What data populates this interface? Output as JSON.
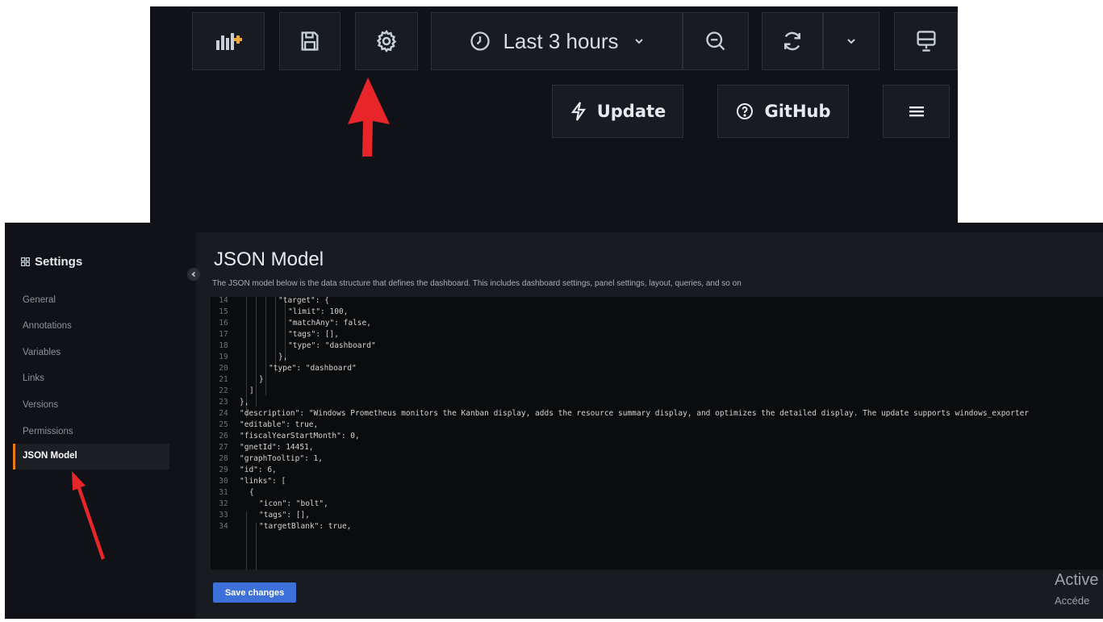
{
  "toolbar": {
    "time_range": "Last 3 hours",
    "update_label": "Update",
    "github_label": "GitHub"
  },
  "icons": [
    "add-panel-icon",
    "save-icon",
    "gear-icon",
    "clock-icon",
    "chevron-down-icon",
    "zoom-out-icon",
    "refresh-icon",
    "tv-icon",
    "bolt-icon",
    "help-circle-icon",
    "hamburger-icon",
    "arrow-up-icon",
    "arrow-icon",
    "grid-icon",
    "chevron-left-icon"
  ],
  "colors": {
    "accent_orange": "#eb7b18",
    "primary_blue": "#3d71d9",
    "arrow_red": "#e8262a",
    "panel_bg": "#181b1f",
    "page_bg": "#111217"
  },
  "sidebar": {
    "title": "Settings",
    "items": [
      {
        "label": "General"
      },
      {
        "label": "Annotations"
      },
      {
        "label": "Variables"
      },
      {
        "label": "Links"
      },
      {
        "label": "Versions"
      },
      {
        "label": "Permissions"
      },
      {
        "label": "JSON Model"
      }
    ]
  },
  "main": {
    "title": "JSON Model",
    "description": "The JSON model below is the data structure that defines the dashboard. This includes dashboard settings, panel settings, layout, queries, and so on",
    "save_label": "Save changes"
  },
  "editor": {
    "lines": [
      {
        "n": "14",
        "text": "\"target\": {"
      },
      {
        "n": "15",
        "text": "\"limit\": 100,"
      },
      {
        "n": "16",
        "text": "\"matchAny\": false,"
      },
      {
        "n": "17",
        "text": "\"tags\": [],"
      },
      {
        "n": "18",
        "text": "\"type\": \"dashboard\""
      },
      {
        "n": "19",
        "text": "},"
      },
      {
        "n": "20",
        "text": "\"type\": \"dashboard\""
      },
      {
        "n": "21",
        "text": "}"
      },
      {
        "n": "22",
        "text": "]"
      },
      {
        "n": "23",
        "text": "},"
      },
      {
        "n": "24",
        "text": "\"description\": \"Windows Prometheus monitors the Kanban display, adds the resource summary display, and optimizes the detailed display. The update supports windows_exporter"
      },
      {
        "n": "25",
        "text": "\"editable\": true,"
      },
      {
        "n": "26",
        "text": "\"fiscalYearStartMonth\": 0,"
      },
      {
        "n": "27",
        "text": "\"gnetId\": 14451,"
      },
      {
        "n": "28",
        "text": "\"graphTooltip\": 1,"
      },
      {
        "n": "29",
        "text": "\"id\": 6,"
      },
      {
        "n": "30",
        "text": "\"links\": ["
      },
      {
        "n": "31",
        "text": "{"
      },
      {
        "n": "32",
        "text": "\"icon\": \"bolt\","
      },
      {
        "n": "33",
        "text": "\"tags\": [],"
      },
      {
        "n": "34",
        "text": "\"targetBlank\": true,"
      }
    ]
  },
  "watermark": {
    "line1": "Active",
    "line2": "Accéde"
  }
}
